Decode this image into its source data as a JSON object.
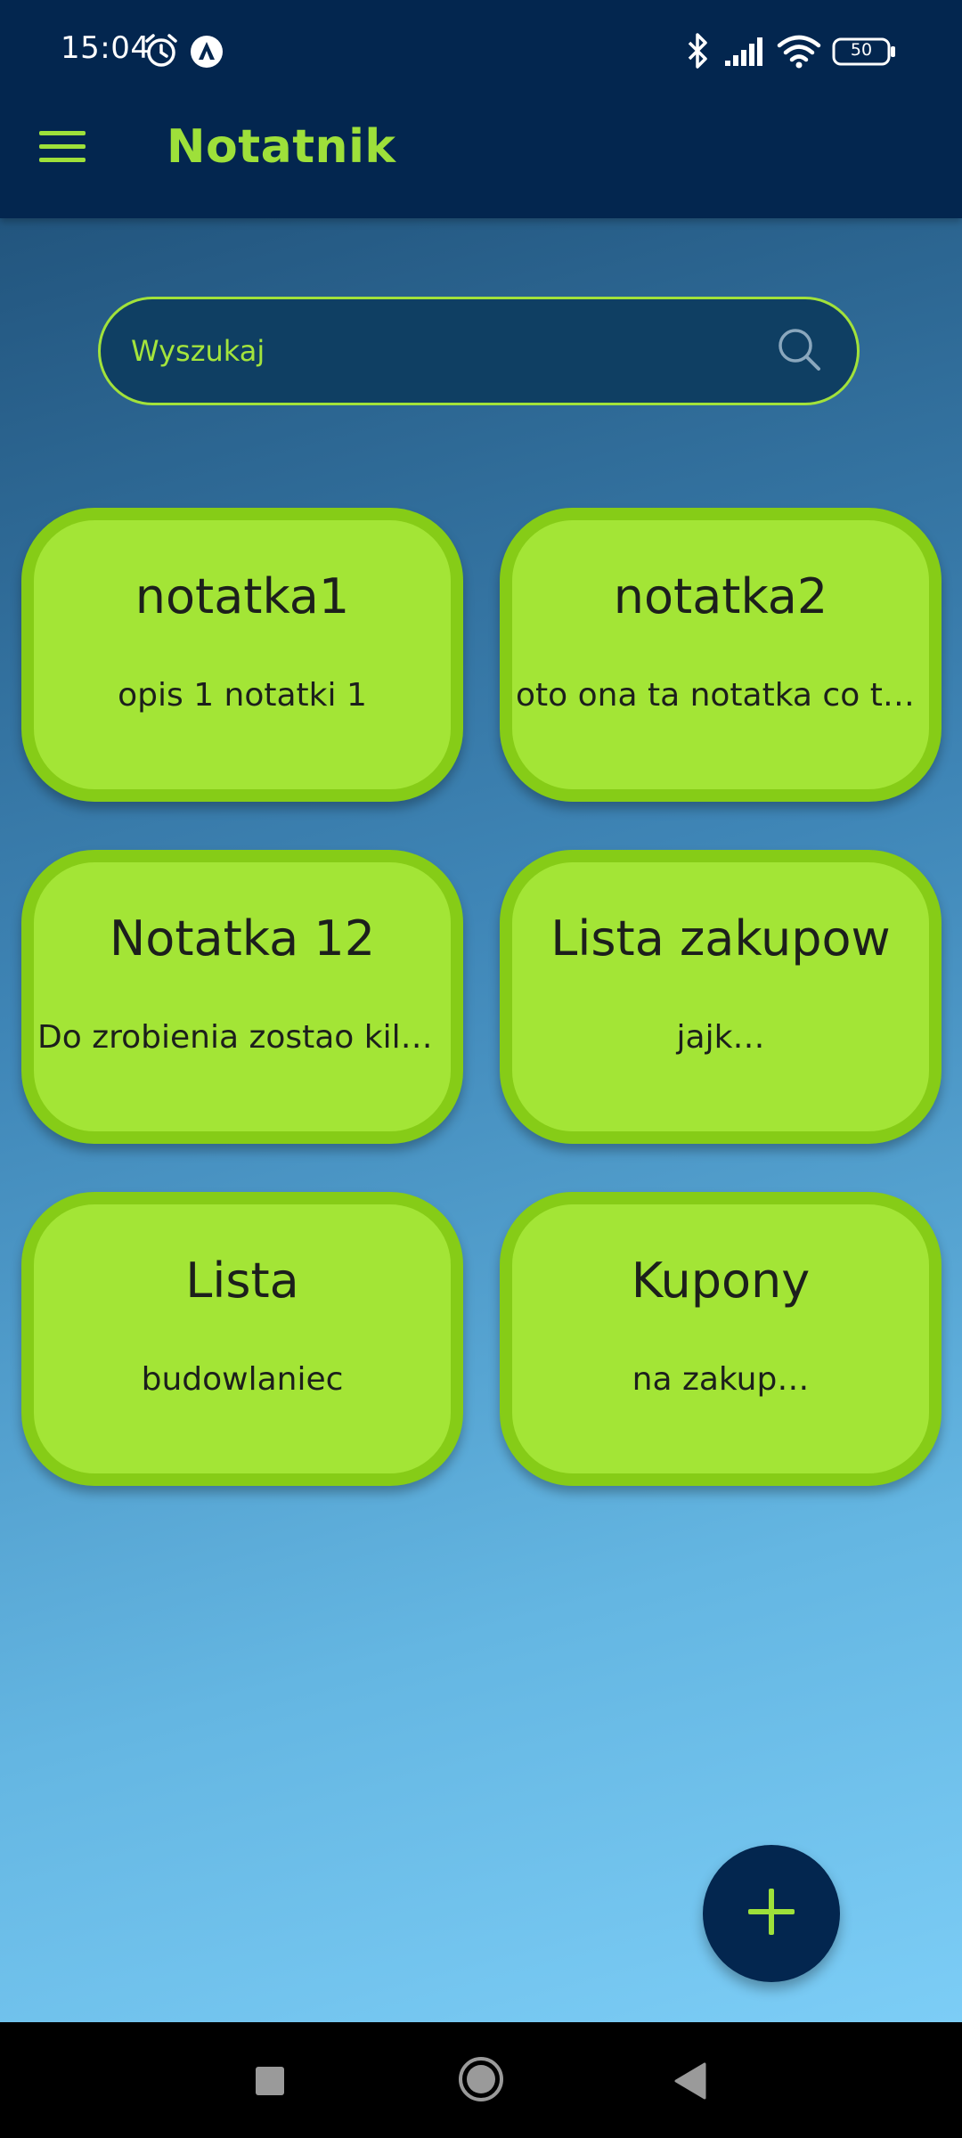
{
  "status_bar": {
    "time": "15:04",
    "battery": "50",
    "icons": [
      "alarm-icon",
      "app-notification-icon",
      "bluetooth-icon",
      "signal-icon",
      "wifi-icon",
      "battery-icon"
    ]
  },
  "app_bar": {
    "title": "Notatnik",
    "menu_icon": "hamburger-menu-icon"
  },
  "search": {
    "placeholder": "Wyszukaj",
    "value": "",
    "icon": "search-icon"
  },
  "notes": [
    {
      "title": "notatka1",
      "description": "opis 1 notatki 1"
    },
    {
      "title": "notatka2",
      "description": "oto ona ta notatka co to j…"
    },
    {
      "title": "Notatka 12",
      "description": "Do zrobienia zostao kilk…"
    },
    {
      "title": "Lista zakupow",
      "description": "jajk…"
    },
    {
      "title": "Lista",
      "description": "budowlaniec"
    },
    {
      "title": "Kupony",
      "description": "na zakup…"
    }
  ],
  "fab": {
    "icon": "plus-icon"
  },
  "nav_bar": {
    "icons": [
      "recents-icon",
      "home-icon",
      "back-icon"
    ]
  },
  "colors": {
    "app_bar_bg": "#03264f",
    "accent_green": "#9ee03a",
    "card_bg": "#a3e536",
    "card_border": "#86cc17",
    "content_gradient_top": "#22557e",
    "content_gradient_bottom": "#7ccdf6"
  }
}
